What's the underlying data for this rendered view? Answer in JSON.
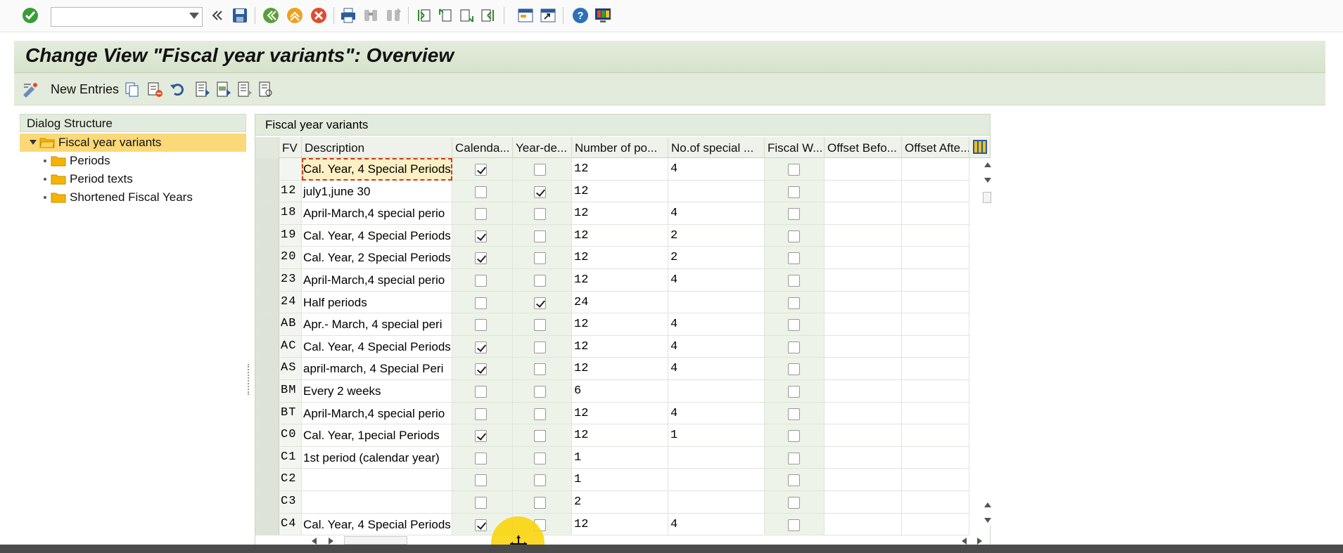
{
  "system_toolbar": {
    "command_field": {
      "value": "",
      "placeholder": ""
    },
    "buttons": [
      {
        "name": "enter-icon",
        "color": "#3a9c3a"
      },
      {
        "name": "collapse-icon"
      },
      {
        "name": "save-icon"
      },
      {
        "name": "back-icon"
      },
      {
        "name": "exit-icon"
      },
      {
        "name": "cancel-icon"
      },
      {
        "name": "print-icon"
      },
      {
        "name": "find-icon"
      },
      {
        "name": "find-next-icon"
      },
      {
        "name": "first-page-icon"
      },
      {
        "name": "previous-page-icon"
      },
      {
        "name": "next-page-icon"
      },
      {
        "name": "last-page-icon"
      },
      {
        "name": "new-session-icon"
      },
      {
        "name": "shortcut-icon"
      },
      {
        "name": "help-icon"
      },
      {
        "name": "customize-layout-icon"
      }
    ]
  },
  "title": "Change View \"Fiscal year variants\": Overview",
  "app_toolbar": {
    "new_entries_label": "New Entries"
  },
  "dialog_structure": {
    "header": "Dialog Structure",
    "items": [
      {
        "label": "Fiscal year variants",
        "level": 0,
        "selected": true,
        "expanded": true
      },
      {
        "label": "Periods",
        "level": 1
      },
      {
        "label": "Period texts",
        "level": 1
      },
      {
        "label": "Shortened Fiscal Years",
        "level": 1
      }
    ]
  },
  "table": {
    "title": "Fiscal year variants",
    "columns": [
      "FV",
      "Description",
      "Calenda...",
      "Year-de...",
      "Number of po...",
      "No.of special ...",
      "Fiscal W...",
      "Offset Befo...",
      "Offset Afte..."
    ],
    "rows": [
      {
        "fv": "",
        "description": "Cal. Year, 4 Special Periods",
        "calendar": true,
        "year_dep": false,
        "periods": "12",
        "special": "4",
        "fiscal_w": false,
        "focused": true
      },
      {
        "fv": "12",
        "description": "july1,june 30",
        "calendar": false,
        "year_dep": true,
        "periods": "12",
        "special": "",
        "fiscal_w": false
      },
      {
        "fv": "18",
        "description": "April-March,4 special perio",
        "calendar": false,
        "year_dep": false,
        "periods": "12",
        "special": "4",
        "fiscal_w": false
      },
      {
        "fv": "19",
        "description": "Cal. Year, 4 Special Periods",
        "calendar": true,
        "year_dep": false,
        "periods": "12",
        "special": "2",
        "fiscal_w": false
      },
      {
        "fv": "20",
        "description": "Cal. Year, 2 Special Periods",
        "calendar": true,
        "year_dep": false,
        "periods": "12",
        "special": "2",
        "fiscal_w": false
      },
      {
        "fv": "23",
        "description": "April-March,4 special perio",
        "calendar": false,
        "year_dep": false,
        "periods": "12",
        "special": "4",
        "fiscal_w": false
      },
      {
        "fv": "24",
        "description": "Half periods",
        "calendar": false,
        "year_dep": true,
        "periods": "24",
        "special": "",
        "fiscal_w": false
      },
      {
        "fv": "AB",
        "description": "Apr.- March, 4 special peri",
        "calendar": false,
        "year_dep": false,
        "periods": "12",
        "special": "4",
        "fiscal_w": false
      },
      {
        "fv": "AC",
        "description": "Cal. Year, 4 Special Periods",
        "calendar": true,
        "year_dep": false,
        "periods": "12",
        "special": "4",
        "fiscal_w": false
      },
      {
        "fv": "AS",
        "description": "april-march, 4 Special Peri",
        "calendar": true,
        "year_dep": false,
        "periods": "12",
        "special": "4",
        "fiscal_w": false
      },
      {
        "fv": "BM",
        "description": "Every 2 weeks",
        "calendar": false,
        "year_dep": false,
        "periods": "6",
        "special": "",
        "fiscal_w": false
      },
      {
        "fv": "BT",
        "description": "April-March,4 special perio",
        "calendar": false,
        "year_dep": false,
        "periods": "12",
        "special": "4",
        "fiscal_w": false
      },
      {
        "fv": "C0",
        "description": "Cal. Year, 1pecial Periods",
        "calendar": true,
        "year_dep": false,
        "periods": "12",
        "special": "1",
        "fiscal_w": false
      },
      {
        "fv": "C1",
        "description": "1st period (calendar year)",
        "calendar": false,
        "year_dep": false,
        "periods": "1",
        "special": "",
        "fiscal_w": false
      },
      {
        "fv": "C2",
        "description": "",
        "calendar": false,
        "year_dep": false,
        "periods": "1",
        "special": "",
        "fiscal_w": false
      },
      {
        "fv": "C3",
        "description": "",
        "calendar": false,
        "year_dep": false,
        "periods": "2",
        "special": "",
        "fiscal_w": false
      },
      {
        "fv": "C4",
        "description": "Cal. Year, 4 Special Periods",
        "calendar": true,
        "year_dep": false,
        "periods": "12",
        "special": "4",
        "fiscal_w": false
      }
    ]
  },
  "colors": {
    "title_bar": "#d5e2cb",
    "selected_tree_item": "#fbd978",
    "focus_border": "#d23a1e",
    "folder": "#f5b400"
  }
}
